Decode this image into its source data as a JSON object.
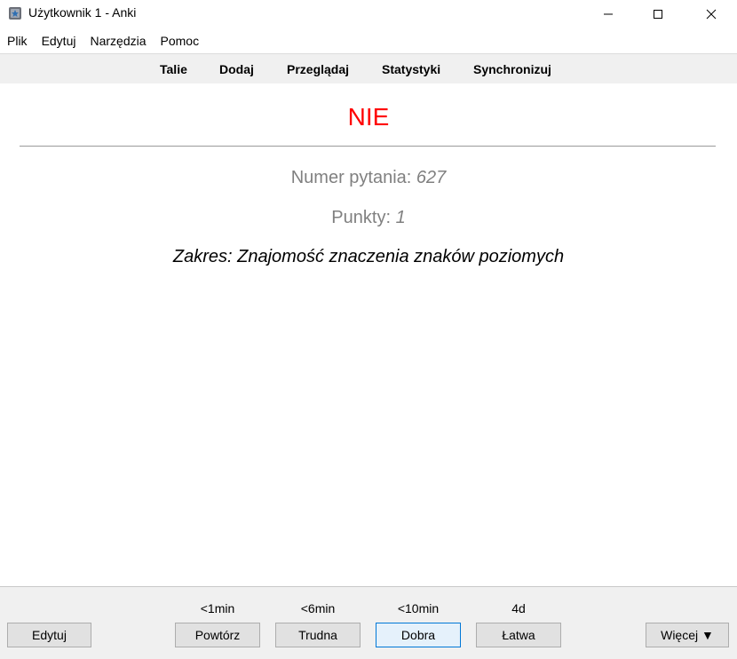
{
  "window": {
    "title": "Użytkownik 1 - Anki",
    "controls": [
      "minimize-icon",
      "maximize-icon",
      "close-icon"
    ]
  },
  "menu": {
    "items": [
      "Plik",
      "Edytuj",
      "Narzędzia",
      "Pomoc"
    ]
  },
  "toolbar": {
    "items": [
      "Talie",
      "Dodaj",
      "Przeglądaj",
      "Statystyki",
      "Synchronizuj"
    ]
  },
  "card": {
    "answer": "NIE",
    "question_number_label": "Numer pytania:",
    "question_number_value": "627",
    "points_label": "Punkty:",
    "points_value": "1",
    "scope": "Zakres: Znajomość znaczenia znaków poziomych"
  },
  "bottom": {
    "edit_label": "Edytuj",
    "intervals": [
      "<1min",
      "<6min",
      "<10min",
      "4d"
    ],
    "answers": [
      "Powtórz",
      "Trudna",
      "Dobra",
      "Łatwa"
    ],
    "more_label": "Więcej ▼"
  },
  "colors": {
    "answer": "#ff0000",
    "muted": "#808080",
    "toolbar_bg": "#f0f0f0",
    "focus_border": "#0078d7"
  }
}
